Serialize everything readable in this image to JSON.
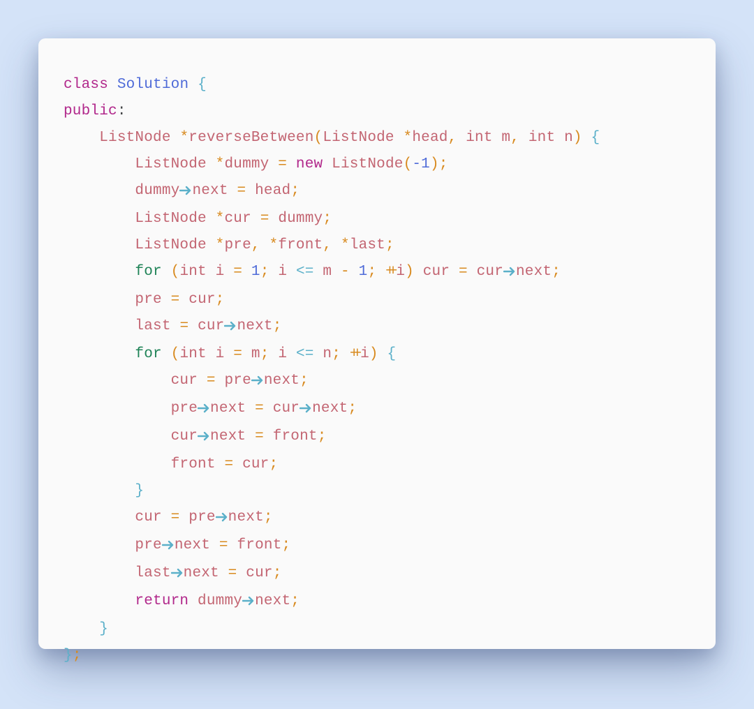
{
  "colors": {
    "background": "#d4e3f8",
    "card": "#fafafa",
    "keyword": "#b1288b",
    "classname": "#4f6bd8",
    "type_ident": "#c36572",
    "operator": "#d88a1f",
    "brace_arrow": "#5bb0c9",
    "flow": "#1f8357",
    "number": "#4f6bd8",
    "text": "#434547"
  },
  "kw": {
    "class": "class",
    "public": "public",
    "new": "new",
    "return": "return",
    "for": "for",
    "int": "int"
  },
  "sym": {
    "Solution": "Solution",
    "ListNode": "ListNode",
    "reverseBetween": "reverseBetween",
    "head": "head",
    "m": "m",
    "n": "n",
    "dummy": "dummy",
    "next": "next",
    "cur": "cur",
    "pre": "pre",
    "front": "front",
    "last": "last",
    "i": "i"
  },
  "num": {
    "neg1": "-1",
    "one": "1"
  },
  "op": {
    "star": "*",
    "eq": "=",
    "comma": ",",
    "semi": ";",
    "colon": ":",
    "lparen": "(",
    "rparen": ")",
    "lbrace": "{",
    "rbrace": "}",
    "lte": "<=",
    "minus": "-",
    "plusplus": "++"
  }
}
